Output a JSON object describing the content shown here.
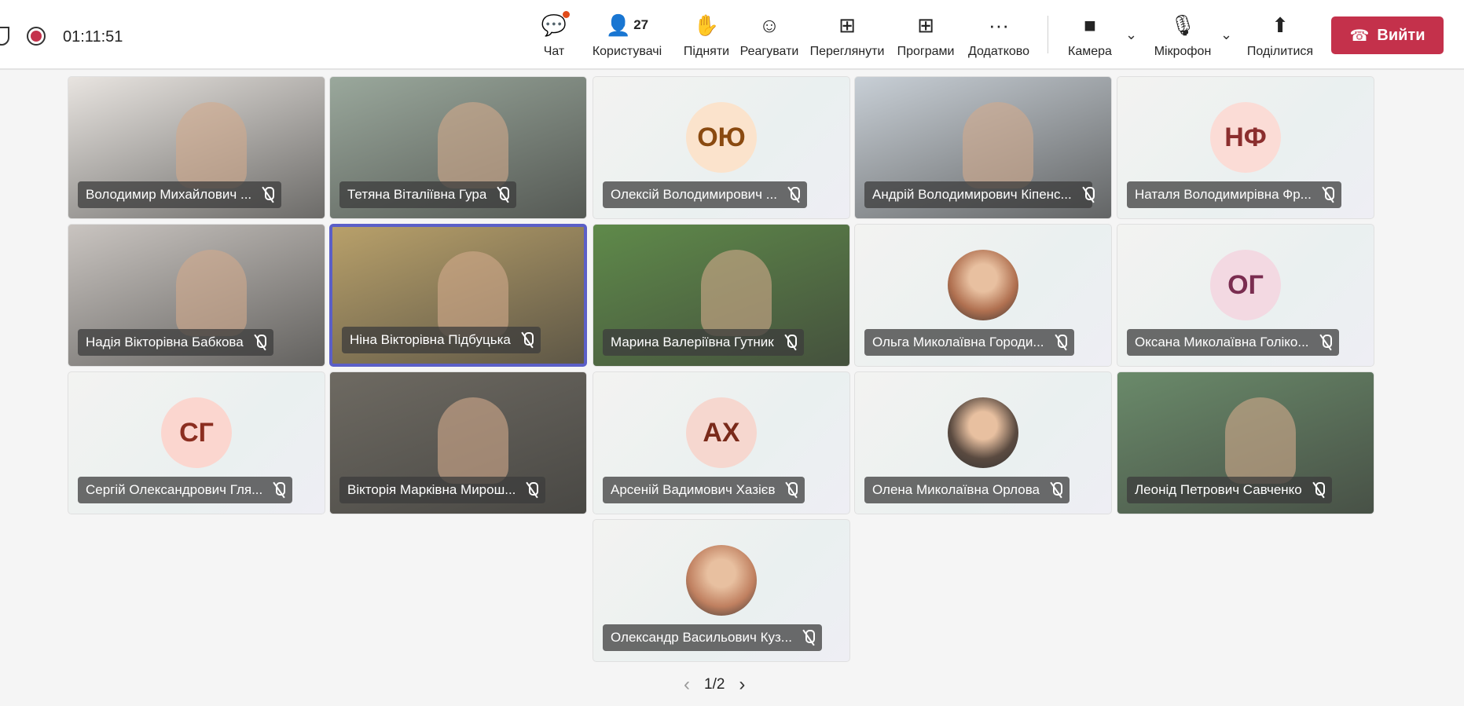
{
  "header": {
    "timer": "01:11:51",
    "buttons": [
      {
        "id": "chat",
        "label": "Чат",
        "icon": "chat-icon",
        "glyph": "💬"
      },
      {
        "id": "people",
        "label": "Користувачі",
        "icon": "people-icon",
        "glyph": "👤",
        "count": "27"
      },
      {
        "id": "raise",
        "label": "Підняти",
        "icon": "raise-hand-icon",
        "glyph": "✋"
      },
      {
        "id": "react",
        "label": "Реагувати",
        "icon": "smiley-icon",
        "glyph": "☺"
      },
      {
        "id": "view",
        "label": "Переглянути",
        "icon": "view-grid-icon",
        "glyph": "⊞"
      },
      {
        "id": "apps",
        "label": "Програми",
        "icon": "apps-plus-icon",
        "glyph": "⊞"
      },
      {
        "id": "more",
        "label": "Додатково",
        "icon": "more-icon",
        "glyph": "···"
      },
      {
        "id": "camera",
        "label": "Камера",
        "icon": "camera-icon",
        "glyph": "■"
      },
      {
        "id": "mic",
        "label": "Мікрофон",
        "icon": "mic-off-icon",
        "glyph": "🎙"
      },
      {
        "id": "share",
        "label": "Поділитися",
        "icon": "share-icon",
        "glyph": "⬆"
      }
    ],
    "leave_label": "Вийти"
  },
  "participants": [
    {
      "name": "Володимир Михайлович ...",
      "type": "video",
      "bg": "#e8e4e0"
    },
    {
      "name": "Тетяна Віталіївна Гура",
      "type": "video",
      "bg": "#9aa89c"
    },
    {
      "name": "Олексій Володимирович ...",
      "type": "initials",
      "initials": "ОЮ",
      "c": "#fbe3cc",
      "t": "#8a4a10"
    },
    {
      "name": "Андрій Володимирович Кіпенс...",
      "type": "video",
      "bg": "#c8cfd6"
    },
    {
      "name": "Наталя Володимирівна Фр...",
      "type": "initials",
      "initials": "НФ",
      "c": "#fbdcd6",
      "t": "#8b2e2e"
    },
    {
      "name": "Надія Вікторівна Бабкова",
      "type": "video",
      "bg": "#c9c4c0"
    },
    {
      "name": "Ніна Вікторівна Підбуцька",
      "type": "video",
      "bg": "#b8a06a",
      "selected": true
    },
    {
      "name": "Марина Валеріївна Гутник",
      "type": "video",
      "bg": "#5f8a4a"
    },
    {
      "name": "Ольга Миколаївна Городи...",
      "type": "photo",
      "c": "#b07050"
    },
    {
      "name": "Оксана Миколаївна Голіко...",
      "type": "initials",
      "initials": "ОГ",
      "c": "#f3d9e2",
      "t": "#7a2d50"
    },
    {
      "name": "Сергій Олександрович Гля...",
      "type": "initials",
      "initials": "СГ",
      "c": "#fbd6cf",
      "t": "#8b2e20"
    },
    {
      "name": "Вікторія Марківна Мирош...",
      "type": "video",
      "bg": "#6e6a62"
    },
    {
      "name": "Арсеній Вадимович Хазієв",
      "type": "initials",
      "initials": "АХ",
      "c": "#f6d7cf",
      "t": "#7a2a1a"
    },
    {
      "name": "Олена Миколаївна Орлова",
      "type": "photo",
      "c": "#5a4a40"
    },
    {
      "name": "Леонід Петрович Савченко",
      "type": "video",
      "bg": "#6a8a6a"
    },
    {
      "name": "Олександр Васильович Куз...",
      "type": "photo",
      "c": "#c08060"
    }
  ],
  "pager": {
    "label": "1/2"
  }
}
